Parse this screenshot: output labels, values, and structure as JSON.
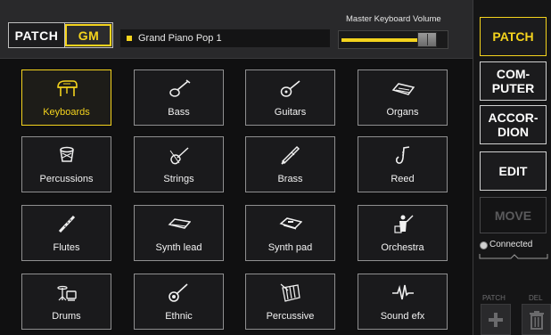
{
  "header": {
    "mode_toggle": {
      "patch_label": "PATCH",
      "gm_label": "GM",
      "selected": "GM"
    },
    "patch_name": "Grand Piano Pop 1",
    "volume": {
      "label": "Master Keyboard Volume",
      "level_percent": 88
    }
  },
  "categories": [
    {
      "label": "Keyboards",
      "icon": "grand-piano-icon",
      "active": true
    },
    {
      "label": "Bass",
      "icon": "bass-guitar-icon",
      "active": false
    },
    {
      "label": "Guitars",
      "icon": "acoustic-guitar-icon",
      "active": false
    },
    {
      "label": "Organs",
      "icon": "organ-keyboard-icon",
      "active": false
    },
    {
      "label": "Percussions",
      "icon": "drum-icon",
      "active": false
    },
    {
      "label": "Strings",
      "icon": "violin-icon",
      "active": false
    },
    {
      "label": "Brass",
      "icon": "trumpet-icon",
      "active": false
    },
    {
      "label": "Reed",
      "icon": "saxophone-icon",
      "active": false
    },
    {
      "label": "Flutes",
      "icon": "flute-icon",
      "active": false
    },
    {
      "label": "Synth lead",
      "icon": "synth-keyboard-icon",
      "active": false
    },
    {
      "label": "Synth pad",
      "icon": "synth-pad-icon",
      "active": false
    },
    {
      "label": "Orchestra",
      "icon": "conductor-icon",
      "active": false
    },
    {
      "label": "Drums",
      "icon": "drum-kit-icon",
      "active": false
    },
    {
      "label": "Ethnic",
      "icon": "banjo-icon",
      "active": false
    },
    {
      "label": "Percussive",
      "icon": "xylophone-icon",
      "active": false
    },
    {
      "label": "Sound efx",
      "icon": "waveform-icon",
      "active": false
    }
  ],
  "sidebar": {
    "patch_label": "PATCH",
    "computer_label": "COM-\nPUTER",
    "accordion_label": "ACCOR-\nDION",
    "edit_label": "EDIT",
    "move_label": "MOVE",
    "connection_status": "Connected",
    "patch_small_label": "PATCH",
    "del_small_label": "DEL"
  },
  "colors": {
    "accent": "#f4d31d",
    "background": "#101011",
    "panel": "#29292b"
  }
}
